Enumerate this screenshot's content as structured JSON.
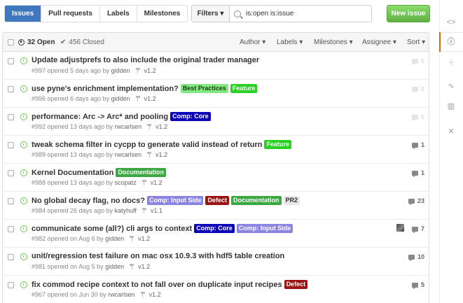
{
  "nav": {
    "tabs": [
      {
        "label": "Issues",
        "active": true
      },
      {
        "label": "Pull requests",
        "active": false
      },
      {
        "label": "Labels",
        "active": false
      },
      {
        "label": "Milestones",
        "active": false
      }
    ]
  },
  "filters": {
    "label": "Filters",
    "query": "is:open is:issue"
  },
  "new_issue": {
    "label": "New issue"
  },
  "header": {
    "open": "32 Open",
    "closed": "456 Closed",
    "author": "Author",
    "labels": "Labels",
    "milestones": "Milestones",
    "assignee": "Assignee",
    "sort": "Sort"
  },
  "issues": [
    {
      "title": "Update adjustprefs to also include the original trader manager",
      "labels": [],
      "meta": "#997 opened 5 days ago by",
      "user": "gidden",
      "milestone": "v1.2",
      "comments": "0",
      "faded": true
    },
    {
      "title": "use pyne's enrichment implementation?",
      "labels": [
        {
          "text": "Best Practices",
          "bg": "#84e880",
          "fg": "#1d3b14"
        },
        {
          "text": "Feature",
          "bg": "#2ad124",
          "fg": "#fff"
        }
      ],
      "meta": "#996 opened 6 days ago by",
      "user": "gidden",
      "milestone": "v1.2",
      "comments": "0",
      "faded": true
    },
    {
      "title": "performance: Arc -> Arc* and pooling",
      "labels": [
        {
          "text": "Comp: Core",
          "bg": "#0b02b9",
          "fg": "#fff"
        }
      ],
      "meta": "#992 opened 13 days ago by",
      "user": "rwcarlsen",
      "milestone": "v1.2",
      "comments": "0",
      "faded": true
    },
    {
      "title": "tweak schema filter in cycpp to generate valid instead of return",
      "labels": [
        {
          "text": "Feature",
          "bg": "#2ad124",
          "fg": "#fff"
        }
      ],
      "meta": "#989 opened 13 days ago by",
      "user": "rwcarlsen",
      "milestone": "v1.2",
      "comments": "1",
      "faded": false
    },
    {
      "title": "Kernel Documentation",
      "labels": [
        {
          "text": "Documentation",
          "bg": "#3ca843",
          "fg": "#fff"
        }
      ],
      "meta": "#988 opened 13 days ago by",
      "user": "scopatz",
      "milestone": "v1.2",
      "comments": "1",
      "faded": false
    },
    {
      "title": "No global decay flag, no docs?",
      "labels": [
        {
          "text": "Comp: Input Side",
          "bg": "#8b84e0",
          "fg": "#fff"
        },
        {
          "text": "Defect",
          "bg": "#9b1313",
          "fg": "#fff"
        },
        {
          "text": "Documentation",
          "bg": "#3ca843",
          "fg": "#fff"
        },
        {
          "text": "PR2",
          "bg": "#e8e8e8",
          "fg": "#333"
        }
      ],
      "meta": "#984 opened 26 days ago by",
      "user": "katyhuff",
      "milestone": "v1.1",
      "comments": "23",
      "faded": false
    },
    {
      "title": "communicate some (all?) cli args to context",
      "labels": [
        {
          "text": "Comp: Core",
          "bg": "#0b02b9",
          "fg": "#fff"
        },
        {
          "text": "Comp: Input Side",
          "bg": "#8b84e0",
          "fg": "#fff"
        }
      ],
      "meta": "#982 opened on Aug 6 by",
      "user": "gidden",
      "milestone": "v1.2",
      "comments": "7",
      "faded": false,
      "avatar": true
    },
    {
      "title": "unit/regression test failure on mac osx 10.9.3 with hdf5 table creation",
      "labels": [],
      "meta": "#981 opened on Aug 5 by",
      "user": "gidden",
      "milestone": "v1.2",
      "comments": "10",
      "faded": false
    },
    {
      "title": "fix commod recipe context to not fall over on duplicate input recipes",
      "labels": [
        {
          "text": "Defect",
          "bg": "#9b1313",
          "fg": "#fff"
        }
      ],
      "meta": "#967 opened on Jun 30 by",
      "user": "rwcarlsen",
      "milestone": "v1.2",
      "comments": "5",
      "faded": false
    }
  ],
  "sidebar": {
    "icons": [
      "code-icon",
      "issue-opened-icon",
      "pull-request-icon",
      "pulse-icon",
      "graph-icon",
      "tools-icon"
    ]
  }
}
